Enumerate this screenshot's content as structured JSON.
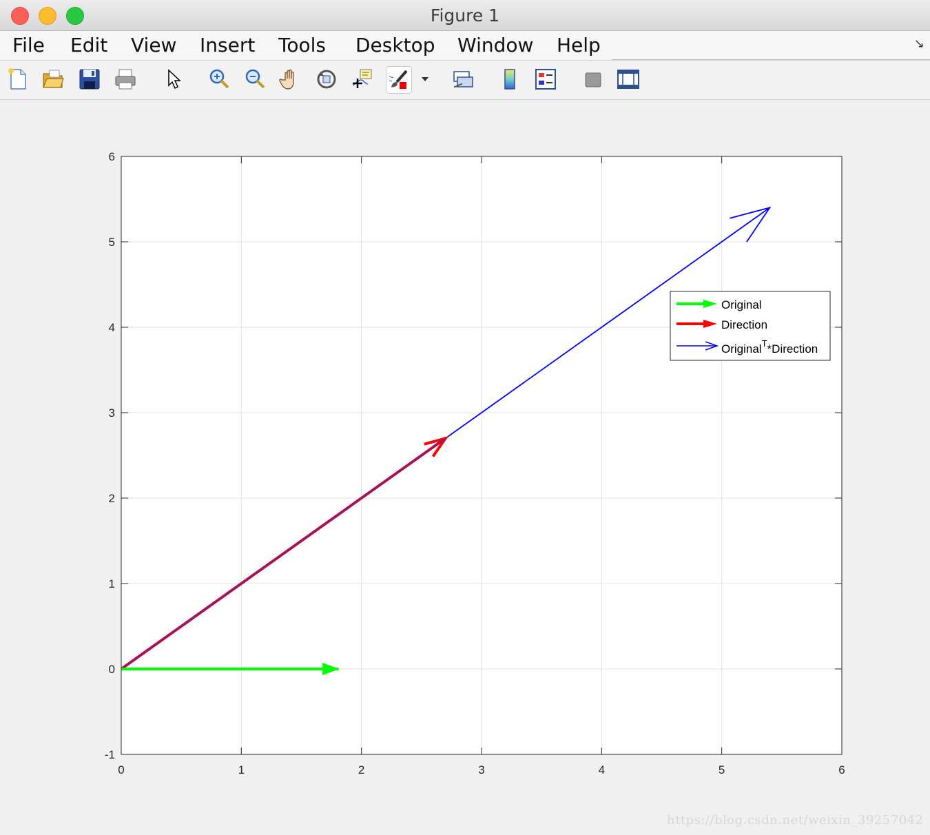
{
  "window": {
    "title": "Figure 1"
  },
  "menu": {
    "items": [
      "File",
      "Edit",
      "View",
      "Insert",
      "Tools",
      "Desktop",
      "Window",
      "Help"
    ]
  },
  "toolbar": {
    "icons": [
      "new-figure-icon",
      "open-file-icon",
      "save-icon",
      "print-icon",
      "pointer-icon",
      "zoom-in-icon",
      "zoom-out-icon",
      "pan-hand-icon",
      "rotate-3d-icon",
      "data-cursor-icon",
      "brush-icon",
      "link-plot-icon",
      "colorbar-icon",
      "legend-icon",
      "hide-plot-tools-icon",
      "show-plot-tools-icon"
    ]
  },
  "colors": {
    "original": "#00ff00",
    "direction": "#ff0000",
    "projection": "#0000ff",
    "overlap": "#7a1d8a"
  },
  "chart_data": {
    "type": "quiver",
    "title": "",
    "xlabel": "",
    "ylabel": "",
    "xlim": [
      0,
      6
    ],
    "ylim": [
      -1,
      6
    ],
    "xticks": [
      0,
      1,
      2,
      3,
      4,
      5,
      6
    ],
    "yticks": [
      -1,
      0,
      1,
      2,
      3,
      4,
      5,
      6
    ],
    "grid": true,
    "legend_position": "upper-right",
    "series": [
      {
        "name": "Original",
        "color": "#00ff00",
        "start": [
          0,
          0
        ],
        "end": [
          1.8,
          0
        ],
        "width": "thick"
      },
      {
        "name": "Direction",
        "color": "#ff0000",
        "start": [
          0,
          0
        ],
        "end": [
          2.7,
          2.7
        ],
        "width": "thick"
      },
      {
        "name": "Original",
        "name_sup": "T",
        "name_suffix": "*Direction",
        "color": "#0000ff",
        "start": [
          0,
          0
        ],
        "end": [
          5.4,
          5.4
        ],
        "width": "thin"
      }
    ]
  },
  "watermark": "https://blog.csdn.net/weixin_39257042"
}
